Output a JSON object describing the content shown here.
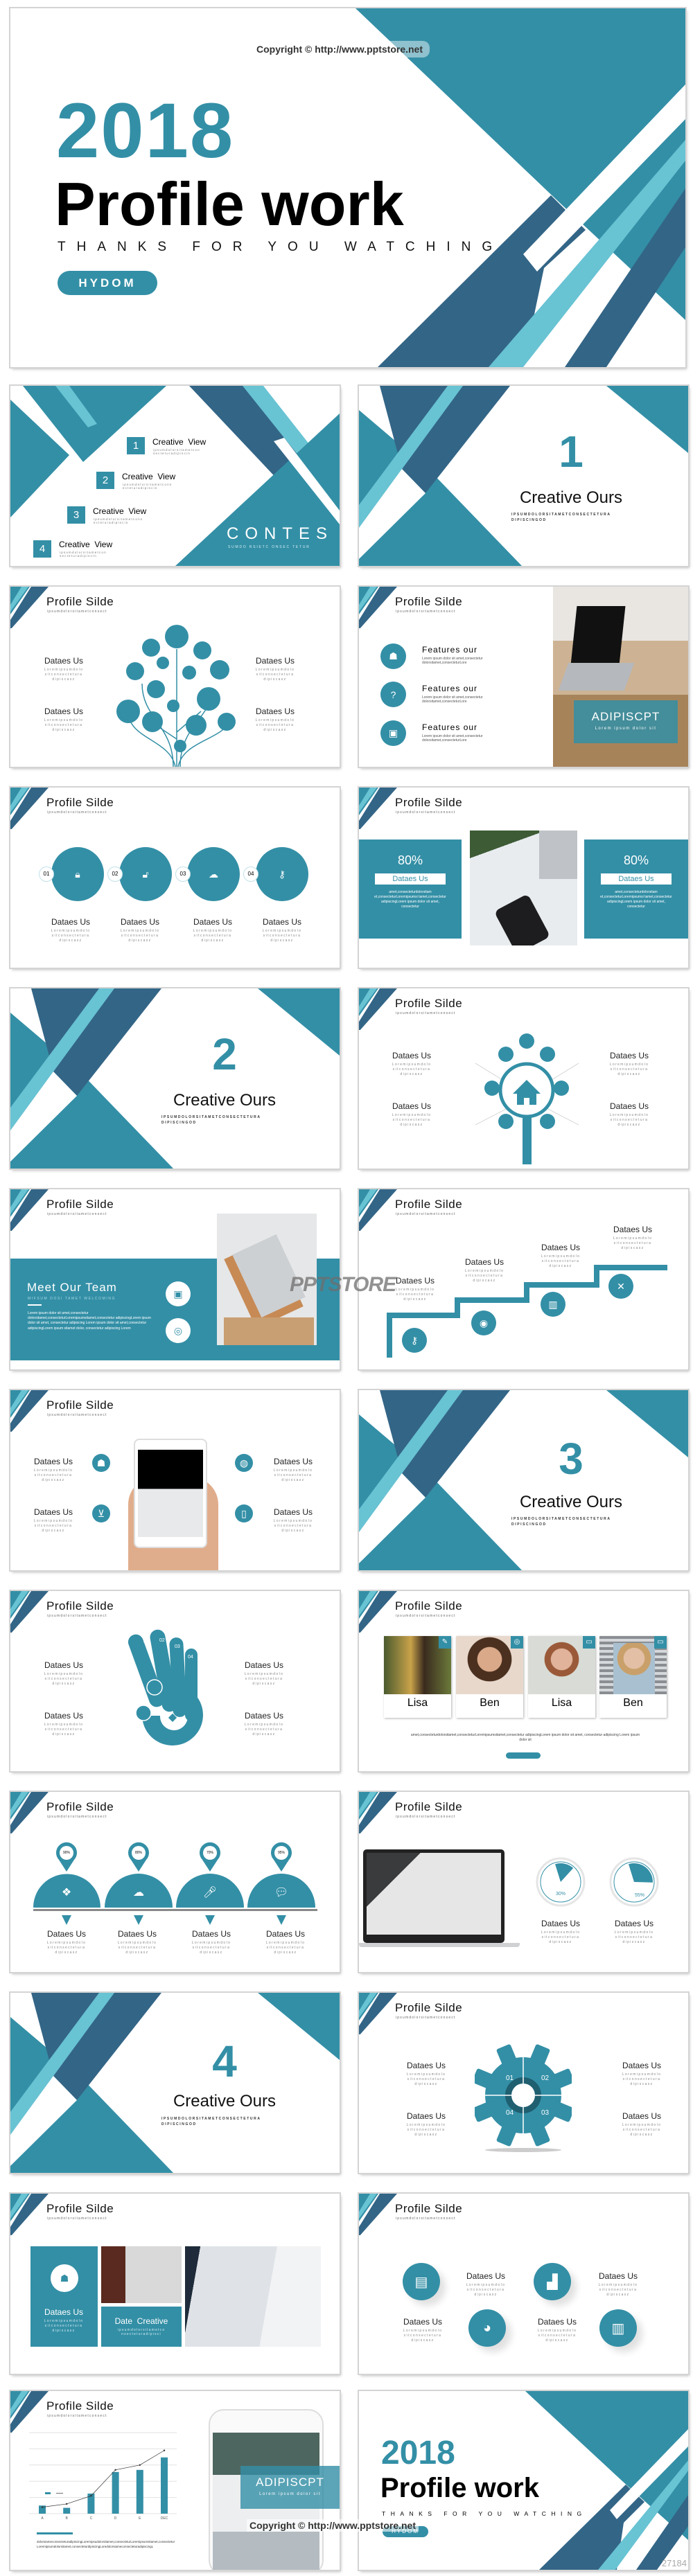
{
  "colors": {
    "teal": "#338fa6",
    "dark": "#336586",
    "light": "#68c3d3"
  },
  "watermarks": {
    "copyright": "Copyright © http://www.pptstore.net",
    "pptstore": "PPTSTORE",
    "id": "27184"
  },
  "common": {
    "slide_title": "Profile Silde",
    "slide_subtitle": "ipsumdolorsitametconsect",
    "item_title": "Dataes Us",
    "item_text": "Loremipsumdolo sitconsectetura dipiscasz"
  },
  "cover": {
    "year": "2018",
    "title": "Profile work",
    "tagline": "THANKS FOR YOU WATCHING",
    "button": "HYDOM"
  },
  "contents": {
    "items": [
      {
        "num": "1",
        "label": "Creative  View",
        "text": "ipsumdolorsitametcon secteturadipiscin"
      },
      {
        "num": "2",
        "label": "Creative  View",
        "text": "ipsumdolorsitametcons ecteturadipiscin"
      },
      {
        "num": "3",
        "label": "Creative  View",
        "text": "ipsumdolorsitametcons ecteturadipiscin"
      },
      {
        "num": "4",
        "label": "Creative  View",
        "text": "ipsumdolorsitametcon secteturadipiscin"
      }
    ],
    "heading": "CONTES",
    "sub": "SUMDO RSIETC ONSEC TETUR"
  },
  "sections": [
    {
      "number": "1",
      "title": "Creative Ours",
      "subtitle": "IPSUMDOLORSITAMETCONSECTETURA DIPISCINGOD"
    },
    {
      "number": "2",
      "title": "Creative Ours",
      "subtitle": "IPSUMDOLORSITAMETCONSECTETURA DIPISCINGOD"
    },
    {
      "number": "3",
      "title": "Creative Ours",
      "subtitle": "IPSUMDOLORSITAMETCONSECTETURA DIPISCINGOD"
    },
    {
      "number": "4",
      "title": "Creative Ours",
      "subtitle": "IPSUMDOLORSITAMETCONSECTETURA DIPISCINGOD"
    }
  ],
  "features": {
    "label": "Features our",
    "text": "Lorem ipsum dolor sit amet,consectetur dolorsitamet,consecteturLore",
    "box_title": "ADIPISCPT",
    "box_text": "Lorem ipsum dolor sit"
  },
  "steps": {
    "numbers": [
      "01",
      "02",
      "03",
      "04"
    ]
  },
  "stats": {
    "value": "80%",
    "label": "Dataes Us",
    "text": "amet,consecteturdolorsitam et,consecteturLoremipsumsi tamet,consectetur adipiscingLorem ipsum dolor sit amet, consectetur"
  },
  "team_intro": {
    "title": "Meet Our Team",
    "sub": "MIFSUM DOSI TAMET WELCOMING",
    "text": "Lorem ipsum dolor sit amet,consectetur dolorsitamet,consecteturLoremipsumsitamet,consectetur adipiscingLorem ipsum dolor sit amet, consectetur adipiscing Lorem ipsum dolor sit amet,consectetur adipiscingLorem ipsum sitamet dolor, consectetur adipiscing Lorem"
  },
  "hand": {
    "numbers": [
      "01",
      "02",
      "03",
      "04"
    ]
  },
  "team": {
    "members": [
      "Lisa",
      "Ben",
      "Lisa",
      "Ben"
    ],
    "text": "amet,consecteturdolorsitamet,consecteturLoremipsumsitamet,consectetur adipiscingLorem ipsum dolor sit amet, consectetur adipiscing Lorem ipsum dolor sit"
  },
  "pins": {
    "percents": [
      "90%",
      "80%",
      "70%",
      "95%"
    ]
  },
  "pies": {
    "percents": [
      "30%",
      "55%"
    ],
    "values": [
      30,
      55
    ]
  },
  "gear": {
    "numbers": [
      "01",
      "02",
      "04",
      "03"
    ]
  },
  "mosaic": {
    "label": "Date  Creative",
    "text": "ipsumdolorsitametco nsecteturadipisci"
  },
  "chart": {
    "categories": [
      "A",
      "B",
      "C",
      "D",
      "E",
      "DEC"
    ],
    "bars": [
      0.5,
      0.36,
      1.24,
      2.57,
      2.7,
      3.47
    ],
    "line": [
      0.4,
      0.6,
      1.1,
      2.7,
      3.0,
      3.9
    ],
    "text": "dolorsiameconsecteturadipiscingLoremipsudolorsitamet,consecteturLoremipsumsitamet,consecteturLoremipsumdolorsitamet,consecteturdipiscingLoredolorsiameconsecteturadipiscingL"
  },
  "phone_box": {
    "title": "ADIPISCPT",
    "text": "Lorem ipsum dolor sit"
  }
}
